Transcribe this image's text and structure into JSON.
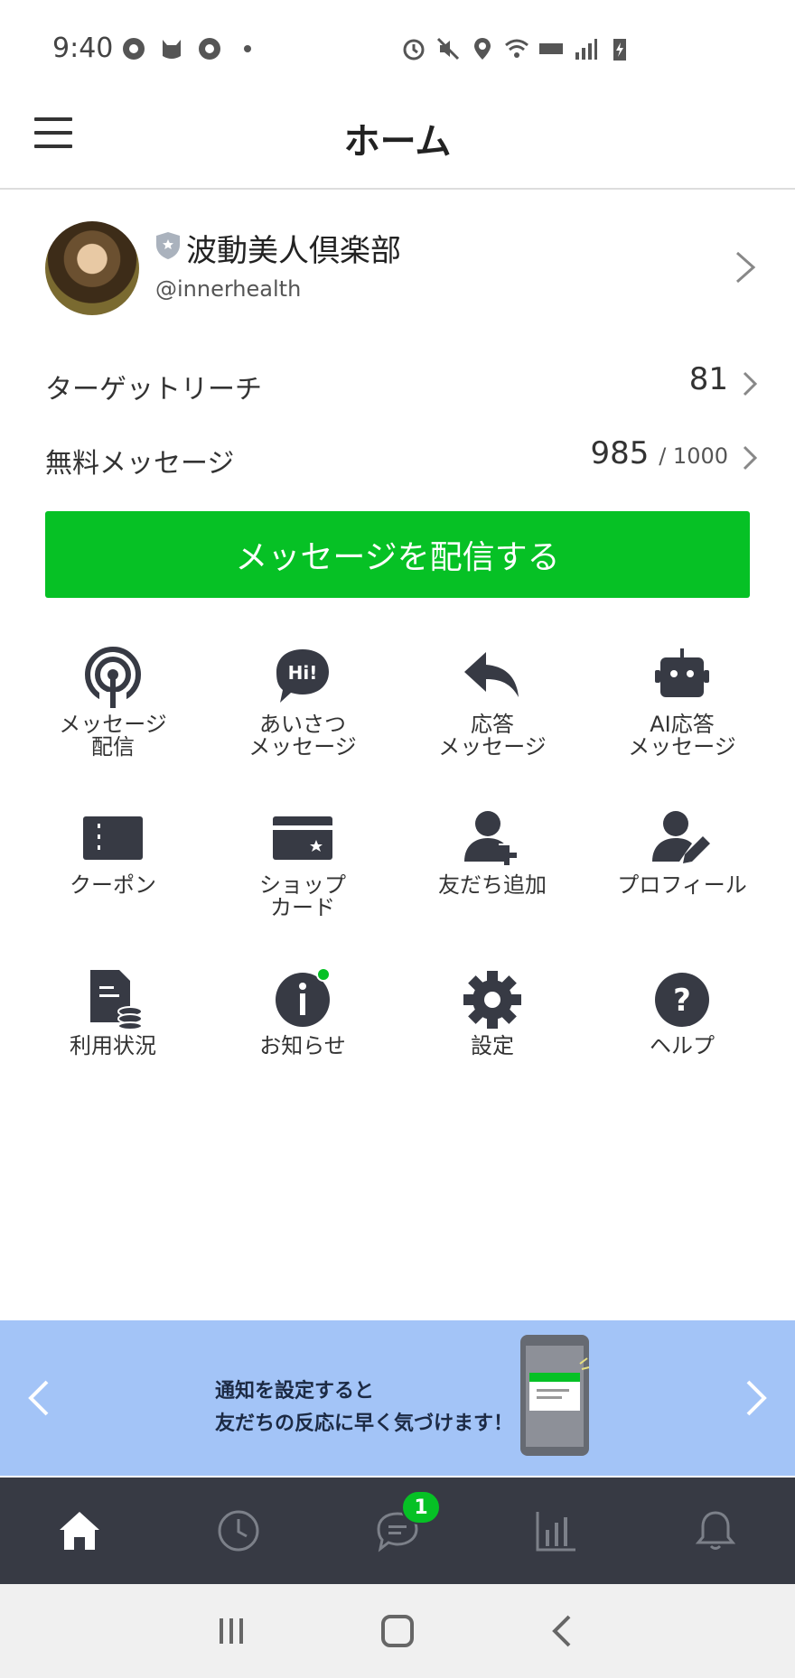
{
  "status_bar": {
    "time": "9:40",
    "left_icons": [
      "chrome-icon",
      "cat-icon",
      "chrome-icon",
      "dot-icon"
    ],
    "right_icons": [
      "alarm-icon",
      "mute-icon",
      "location-icon",
      "wifi-icon",
      "volte-icon",
      "signal-icon",
      "battery-charging-icon"
    ]
  },
  "header": {
    "title": "ホーム"
  },
  "account": {
    "name": "波動美人倶楽部",
    "id": "@innerhealth"
  },
  "stats": {
    "target_reach": {
      "label": "ターゲットリーチ",
      "value": "81"
    },
    "free_messages": {
      "label": "無料メッセージ",
      "value": "985",
      "limit": "/ 1000"
    }
  },
  "send_button": {
    "label": "メッセージを配信する"
  },
  "menu": {
    "message_broadcast": "メッセージ\n配信",
    "greeting_message": "あいさつ\nメッセージ",
    "auto_reply": "応答\nメッセージ",
    "ai_reply": "AI応答\nメッセージ",
    "coupon": "クーポン",
    "shop_card": "ショップ\nカード",
    "add_friend": "友だち追加",
    "profile": "プロフィール",
    "usage": "利用状況",
    "notices": "お知らせ",
    "settings": "設定",
    "help": "ヘルプ"
  },
  "banner": {
    "line1": "通知を設定すると",
    "line2": "友だちの反応に早く気づけます！"
  },
  "bottom_nav": {
    "items": [
      "home-icon",
      "clock-icon",
      "chat-icon",
      "chart-icon",
      "bell-icon"
    ],
    "chat_badge": "1"
  },
  "colors": {
    "accent": "#06c125",
    "icon": "#373a44",
    "banner_bg": "#a3c4f7",
    "nav_bg": "#373a44"
  }
}
